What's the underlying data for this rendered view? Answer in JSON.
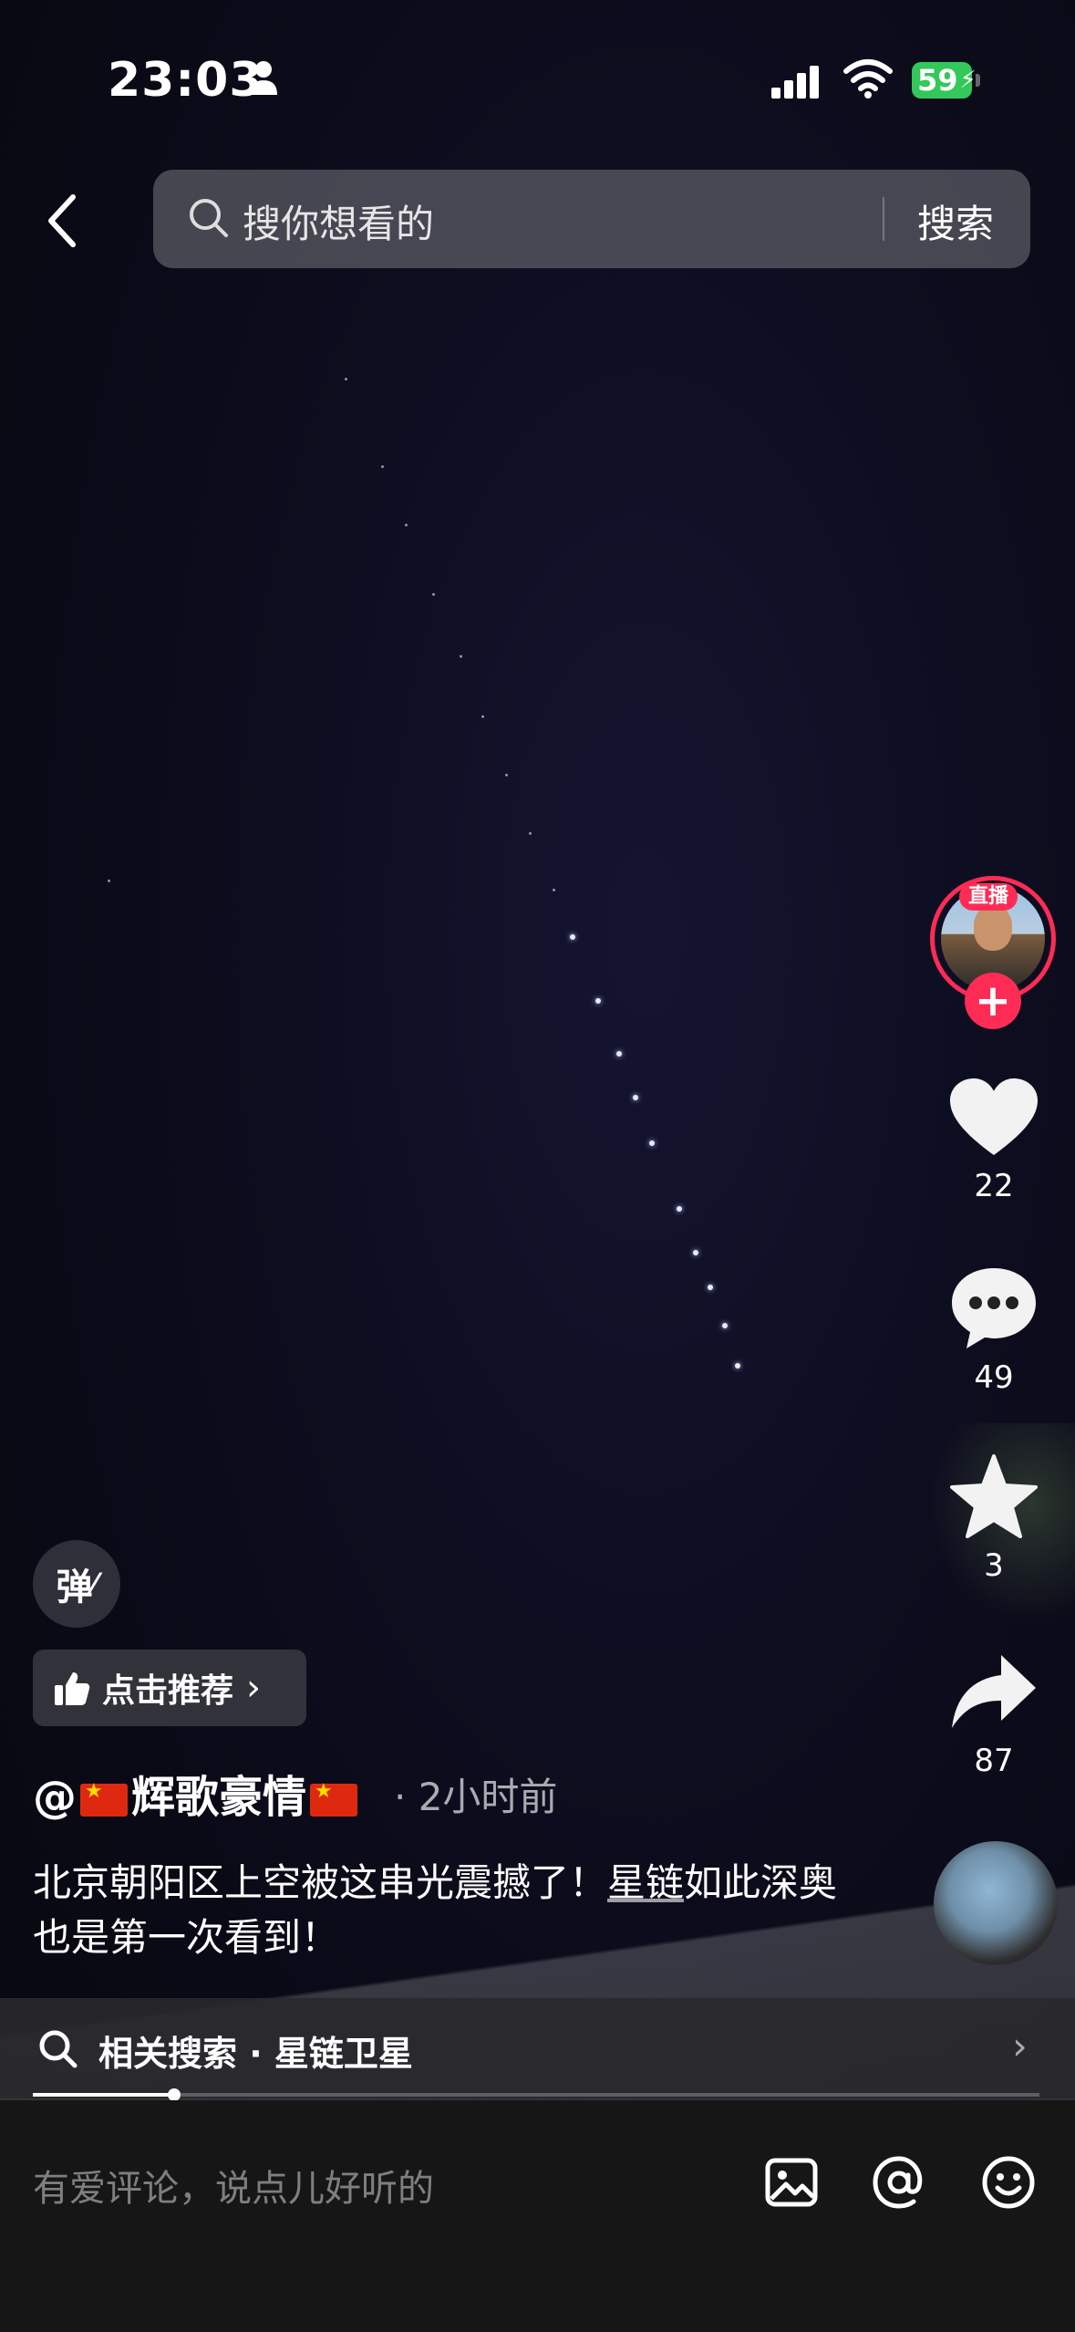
{
  "status_bar": {
    "time": "23:03",
    "battery": "59"
  },
  "top_bar": {
    "search_placeholder": "搜你想看的",
    "search_button": "搜索"
  },
  "creator": {
    "live_badge": "直播",
    "follow_symbol": "+"
  },
  "actions": {
    "likes": "22",
    "comments": "49",
    "favorites": "3",
    "shares": "87"
  },
  "overlay": {
    "danmu_label": "弹",
    "recommend_label": "点击推荐",
    "recommend_chevron": "›"
  },
  "post": {
    "at": "@",
    "author": "辉歌豪情",
    "time": "· 2小时前",
    "caption_part1": "北京朝阳区上空被这串光震撼了！",
    "caption_link": "星链",
    "caption_part2": "如此深奥也是第一次看到！"
  },
  "related_search": {
    "label": "相关搜索 · 星链卫星",
    "chevron": "›"
  },
  "progress": {
    "fraction": 0.14
  },
  "comment_bar": {
    "placeholder": "有爱评论，说点儿好听的"
  },
  "colors": {
    "accent": "#fe2c55",
    "battery": "#34c759"
  }
}
